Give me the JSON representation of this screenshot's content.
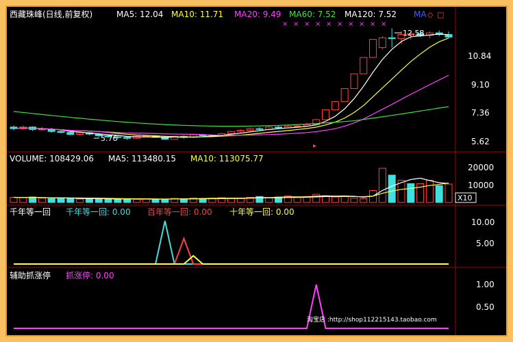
{
  "header": {
    "title": "西藏珠峰(日线,前复权)",
    "ma5": "MA5: 12.04",
    "ma10": "MA10: 11.71",
    "ma20": "MA20: 9.49",
    "ma60": "MA60: 7.52",
    "ma120": "MA120: 7.52",
    "ma_tag": "MA",
    "diamond_icon": "◇",
    "square_icon": "□"
  },
  "price_panel": {
    "axis_ticks": [
      "10.84",
      "9.10",
      "7.36",
      "5.62"
    ],
    "high_label": "12.58",
    "low_label": "5.76",
    "marker_x": "×",
    "marker_arrow": "▸"
  },
  "volume_panel": {
    "label": "VOLUME: 108429.06",
    "ma5": "MA5: 113480.15",
    "ma10": "MA10: 113075.77",
    "axis_ticks": [
      "20000",
      "10000"
    ],
    "unit": "X10"
  },
  "indicator_panel": {
    "title": "千年等一回",
    "series_1": "千年等一回: 0.00",
    "series_2": "百年等一回: 0.00",
    "series_3": "十年等一回: 0.00",
    "axis_ticks": [
      "10.00",
      "5.00"
    ]
  },
  "helper_panel": {
    "title": "辅助抓涨停",
    "series_1": "抓涨停: 0.00",
    "axis_ticks": [
      "1.00",
      "0.50"
    ],
    "watermark": "淘宝店 :http://shop112215143.taobao.com"
  },
  "colors": {
    "background": "#000000",
    "frame": "#e89a2a",
    "up_candle": "#ff4040",
    "down_candle": "#40e0e0",
    "ma5": "#ffffff",
    "ma10": "#ffff40",
    "ma20": "#ff40ff",
    "ma60": "#40e040",
    "panel_border": "#b00000",
    "axis_text": "#ffffff"
  },
  "chart_data": [
    {
      "type": "candlestick",
      "title": "西藏珠峰(日线,前复权)",
      "y_ticks": [
        10.84,
        9.1,
        7.36,
        5.62
      ],
      "annotations": [
        {
          "label": "12.58",
          "kind": "high"
        },
        {
          "label": "5.76",
          "kind": "low"
        }
      ],
      "candles": [
        {
          "o": 6.55,
          "c": 6.45,
          "h": 6.65,
          "l": 6.35
        },
        {
          "o": 6.45,
          "c": 6.55,
          "h": 6.65,
          "l": 6.38
        },
        {
          "o": 6.55,
          "c": 6.4,
          "h": 6.6,
          "l": 6.3
        },
        {
          "o": 6.4,
          "c": 6.42,
          "h": 6.55,
          "l": 6.32
        },
        {
          "o": 6.42,
          "c": 6.28,
          "h": 6.5,
          "l": 6.2
        },
        {
          "o": 6.28,
          "c": 6.22,
          "h": 6.35,
          "l": 6.15
        },
        {
          "o": 6.22,
          "c": 6.1,
          "h": 6.3,
          "l": 6.05
        },
        {
          "o": 6.1,
          "c": 6.2,
          "h": 6.28,
          "l": 6.02
        },
        {
          "o": 6.2,
          "c": 6.12,
          "h": 6.25,
          "l": 6.05
        },
        {
          "o": 6.12,
          "c": 6.02,
          "h": 6.18,
          "l": 5.95
        },
        {
          "o": 6.02,
          "c": 5.95,
          "h": 6.1,
          "l": 5.9
        },
        {
          "o": 5.95,
          "c": 5.92,
          "h": 6.02,
          "l": 5.8
        },
        {
          "o": 5.92,
          "c": 5.86,
          "h": 6.0,
          "l": 5.76
        },
        {
          "o": 5.86,
          "c": 6.0,
          "h": 6.05,
          "l": 5.82
        },
        {
          "o": 6.0,
          "c": 6.02,
          "h": 6.08,
          "l": 5.95
        },
        {
          "o": 6.02,
          "c": 5.92,
          "h": 6.06,
          "l": 5.88
        },
        {
          "o": 5.92,
          "c": 5.8,
          "h": 5.98,
          "l": 5.76
        },
        {
          "o": 5.8,
          "c": 5.98,
          "h": 6.02,
          "l": 5.78
        },
        {
          "o": 5.98,
          "c": 5.92,
          "h": 6.04,
          "l": 5.86
        },
        {
          "o": 5.92,
          "c": 6.08,
          "h": 6.12,
          "l": 5.88
        },
        {
          "o": 6.08,
          "c": 6.02,
          "h": 6.14,
          "l": 5.98
        },
        {
          "o": 6.02,
          "c": 6.05,
          "h": 6.1,
          "l": 5.98
        },
        {
          "o": 6.05,
          "c": 6.15,
          "h": 6.2,
          "l": 6.0
        },
        {
          "o": 6.15,
          "c": 6.28,
          "h": 6.32,
          "l": 6.1
        },
        {
          "o": 6.28,
          "c": 6.35,
          "h": 6.42,
          "l": 6.2
        },
        {
          "o": 6.35,
          "c": 6.45,
          "h": 6.52,
          "l": 6.3
        },
        {
          "o": 6.45,
          "c": 6.4,
          "h": 6.55,
          "l": 6.35
        },
        {
          "o": 6.4,
          "c": 6.55,
          "h": 6.6,
          "l": 6.35
        },
        {
          "o": 6.55,
          "c": 6.5,
          "h": 6.62,
          "l": 6.45
        },
        {
          "o": 6.5,
          "c": 6.6,
          "h": 6.68,
          "l": 6.45
        },
        {
          "o": 6.6,
          "c": 6.62,
          "h": 6.72,
          "l": 6.52
        },
        {
          "o": 6.62,
          "c": 6.7,
          "h": 6.8,
          "l": 6.58
        },
        {
          "o": 6.7,
          "c": 7.0,
          "h": 7.05,
          "l": 6.65
        },
        {
          "o": 7.0,
          "c": 7.6,
          "h": 7.62,
          "l": 7.0
        },
        {
          "o": 7.6,
          "c": 8.1,
          "h": 8.12,
          "l": 7.6
        },
        {
          "o": 8.1,
          "c": 8.9,
          "h": 8.92,
          "l": 8.1
        },
        {
          "o": 8.9,
          "c": 9.8,
          "h": 9.82,
          "l": 8.9
        },
        {
          "o": 9.8,
          "c": 10.8,
          "h": 10.82,
          "l": 9.8
        },
        {
          "o": 10.8,
          "c": 11.9,
          "h": 11.92,
          "l": 10.8
        },
        {
          "o": 11.4,
          "c": 12.0,
          "h": 12.1,
          "l": 11.3
        },
        {
          "o": 12.0,
          "c": 11.95,
          "h": 12.58,
          "l": 11.4
        },
        {
          "o": 11.95,
          "c": 12.2,
          "h": 12.4,
          "l": 11.6
        },
        {
          "o": 12.2,
          "c": 12.25,
          "h": 12.35,
          "l": 11.9
        },
        {
          "o": 12.25,
          "c": 12.15,
          "h": 12.45,
          "l": 12.05
        },
        {
          "o": 12.15,
          "c": 12.3,
          "h": 12.4,
          "l": 11.95
        },
        {
          "o": 12.3,
          "c": 12.2,
          "h": 12.45,
          "l": 12.1
        },
        {
          "o": 12.2,
          "c": 12.04,
          "h": 12.38,
          "l": 11.95
        }
      ]
    },
    {
      "type": "bar",
      "title": "VOLUME",
      "y_ticks": [
        20000,
        10000
      ],
      "values": [
        3000,
        2800,
        3200,
        2500,
        2200,
        2600,
        2400,
        2000,
        2300,
        2100,
        2000,
        1800,
        2200,
        1900,
        2100,
        1700,
        2000,
        2400,
        2200,
        2600,
        2300,
        2500,
        2800,
        2400,
        2600,
        3000,
        3500,
        2800,
        3200,
        3800,
        3000,
        3500,
        4800,
        4000,
        3200,
        3500,
        2500,
        2200,
        7000,
        20000,
        16000,
        13000,
        11000,
        11000,
        13000,
        9800,
        10800
      ],
      "up": [
        1,
        1,
        0,
        1,
        0,
        0,
        0,
        1,
        0,
        0,
        0,
        0,
        0,
        1,
        1,
        0,
        0,
        1,
        0,
        1,
        0,
        1,
        1,
        1,
        1,
        1,
        0,
        1,
        0,
        1,
        1,
        1,
        1,
        1,
        1,
        1,
        1,
        1,
        1,
        1,
        0,
        1,
        0,
        1,
        1,
        0,
        1
      ]
    },
    {
      "type": "line",
      "title": "千年等一回",
      "y_ticks": [
        10.0,
        5.0
      ],
      "series": [
        {
          "name": "千年等一回",
          "peak_index": 16,
          "peak": 10.5
        },
        {
          "name": "百年等一回",
          "peak_index": 18,
          "peak": 6.2
        },
        {
          "name": "十年等一回",
          "peak_index": 19,
          "peak": 2.0
        }
      ]
    },
    {
      "type": "line",
      "title": "辅助抓涨停",
      "y_ticks": [
        1.0,
        0.5
      ],
      "series": [
        {
          "name": "抓涨停",
          "peak_index": 32,
          "peak": 1.0
        }
      ]
    }
  ]
}
